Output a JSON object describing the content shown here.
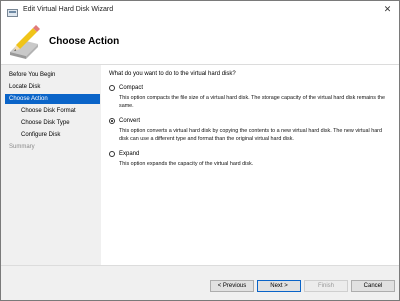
{
  "window": {
    "title": "Edit Virtual Hard Disk Wizard",
    "close_glyph": "✕"
  },
  "header": {
    "title": "Choose Action"
  },
  "sidebar": {
    "items": [
      {
        "label": "Before You Begin"
      },
      {
        "label": "Locate Disk"
      },
      {
        "label": "Choose Action"
      },
      {
        "label": "Choose Disk Format"
      },
      {
        "label": "Choose Disk Type"
      },
      {
        "label": "Configure Disk"
      },
      {
        "label": "Summary"
      }
    ]
  },
  "main": {
    "question": "What do you want to do to the virtual hard disk?",
    "options": [
      {
        "label": "Compact",
        "selected": false,
        "description": "This option compacts the file size of a virtual hard disk. The storage capacity of the virtual hard disk remains the same."
      },
      {
        "label": "Convert",
        "selected": true,
        "description": "This option converts a virtual hard disk by copying the contents to a new virtual hard disk. The new virtual hard disk can use a different type and format than the original virtual hard disk."
      },
      {
        "label": "Expand",
        "selected": false,
        "description": "This option expands the capacity of the virtual hard disk."
      }
    ]
  },
  "footer": {
    "previous_label": "< Previous",
    "next_label": "Next >",
    "finish_label": "Finish",
    "cancel_label": "Cancel"
  },
  "colors": {
    "accent": "#0a64c8"
  }
}
